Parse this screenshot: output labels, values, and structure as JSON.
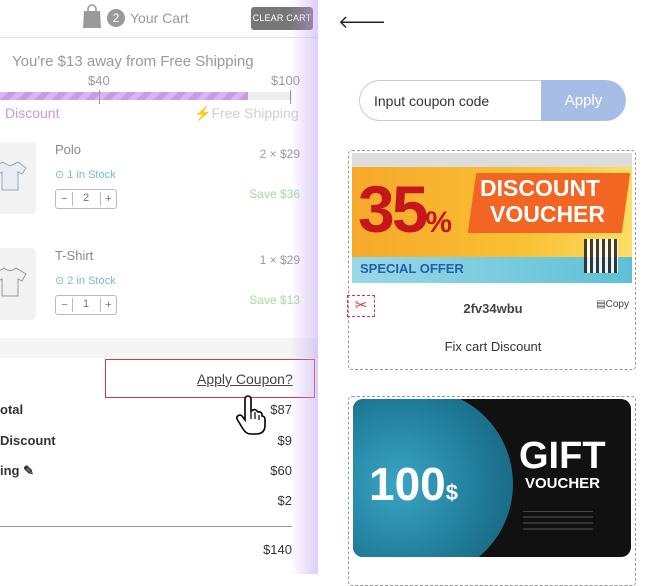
{
  "cart": {
    "count": "2",
    "title": "Your Cart",
    "clear_label": "CLEAR CART",
    "shipping_message": "You're $13 away from Free Shipping",
    "progress": {
      "ticks": [
        "$40",
        "$100"
      ],
      "fill_fraction": 0.85,
      "discount_label": "Discount",
      "free_label": "Free Shipping"
    },
    "items": [
      {
        "name": "Polo",
        "stock": "1 in Stock",
        "qty": "2",
        "price": "2 × $29",
        "save": "Save $36"
      },
      {
        "name": "T-Shirt",
        "stock": "2 in Stock",
        "qty": "1",
        "price": "1 × $29",
        "save": "Save $13"
      }
    ],
    "apply_coupon_link": "Apply Coupon?",
    "totals": [
      {
        "label": "otal",
        "value": "$87"
      },
      {
        "label": "Discount",
        "value": "$9"
      },
      {
        "label": "ing",
        "value": "$60"
      },
      {
        "label": "",
        "value": "$2"
      }
    ],
    "grand_total": "$140"
  },
  "coupon_panel": {
    "input_placeholder": "Input coupon code",
    "apply_label": "Apply",
    "coupons": [
      {
        "percent": "35",
        "percent_sign": "%",
        "line1": "DISCOUNT",
        "line2": "VOUCHER",
        "offer": "SPECIAL OFFER",
        "code": "2fv34wbu",
        "copy_label": "Copy",
        "description": "Fix cart Discount"
      },
      {
        "amount": "100",
        "currency": "$",
        "line1": "GIFT",
        "line2": "VOUCHER"
      }
    ]
  },
  "colors": {
    "accent": "#a7bde6",
    "highlight_red": "#d9363e",
    "discount_purple": "#c69be2"
  }
}
